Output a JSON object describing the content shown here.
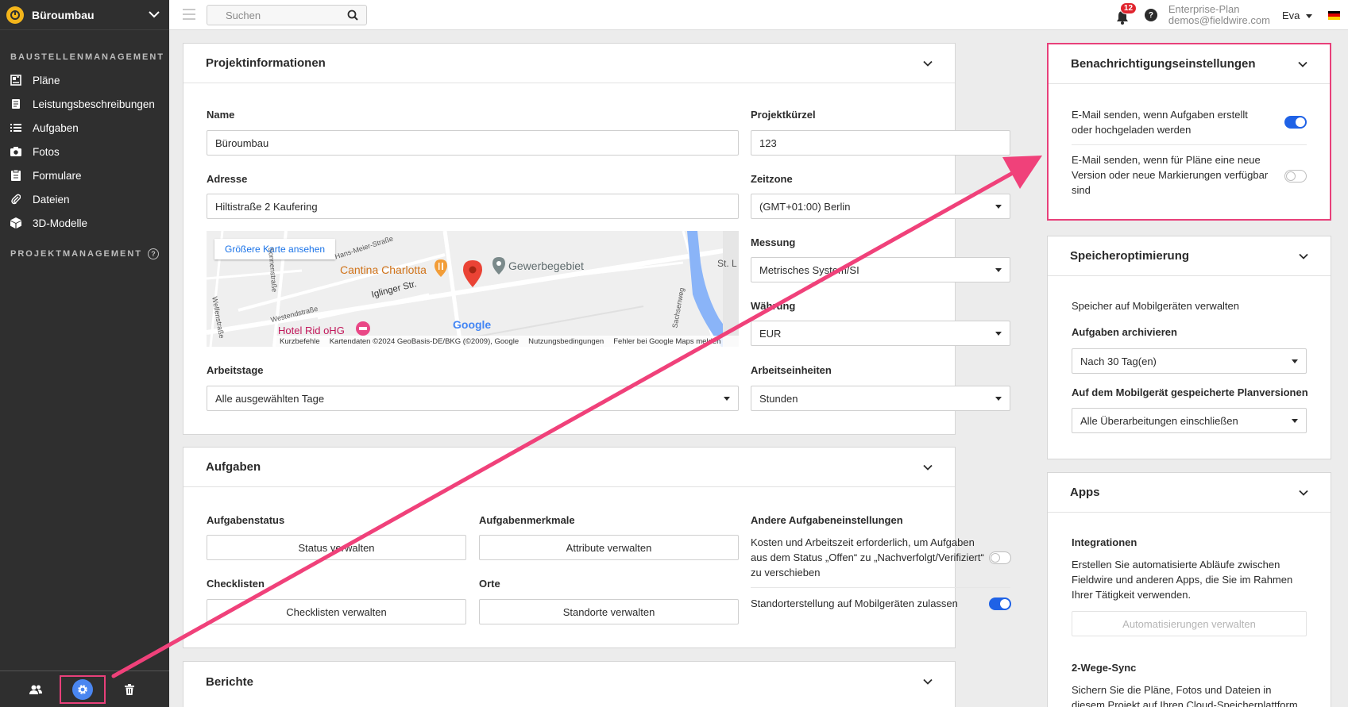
{
  "sidebar": {
    "project_name": "Büroumbau",
    "section_label": "BAUSTELLENMANAGEMENT",
    "items": [
      {
        "label": "Pläne",
        "icon": "plans-icon"
      },
      {
        "label": "Leistungsbeschreibungen",
        "icon": "specifications-icon"
      },
      {
        "label": "Aufgaben",
        "icon": "tasks-icon"
      },
      {
        "label": "Fotos",
        "icon": "camera-icon"
      },
      {
        "label": "Formulare",
        "icon": "forms-icon"
      },
      {
        "label": "Dateien",
        "icon": "paperclip-icon"
      },
      {
        "label": "3D-Modelle",
        "icon": "cube-icon"
      }
    ],
    "pm_label": "PROJEKTMANAGEMENT",
    "help_glyph": "?"
  },
  "topbar": {
    "search_placeholder": "Suchen",
    "notification_count": "12",
    "help_glyph": "?",
    "plan_name": "Enterprise-Plan",
    "account_email": "demos@fieldwire.com",
    "user_name": "Eva"
  },
  "project_info": {
    "title": "Projektinformationen",
    "name_label": "Name",
    "name_value": "Büroumbau",
    "code_label": "Projektkürzel",
    "code_value": "123",
    "address_label": "Adresse",
    "address_value": "Hiltistraße 2 Kaufering",
    "timezone_label": "Zeitzone",
    "timezone_value": "(GMT+01:00) Berlin",
    "measure_label": "Messung",
    "measure_value": "Metrisches System/SI",
    "currency_label": "Währung",
    "currency_value": "EUR",
    "workdays_label": "Arbeitstage",
    "workdays_value": "Alle ausgewählten Tage",
    "workunits_label": "Arbeitseinheiten",
    "workunits_value": "Stunden",
    "map": {
      "button": "Größere Karte ansehen",
      "place1": "Cantina Charlotta",
      "place2": "Gewerbegebiet",
      "place3": "Hotel Rid oHG",
      "street1": "Iglinger Str.",
      "street2": "Hans-Meier-Straße",
      "street3": "Westendstraße",
      "street4": "Sonnenstraße",
      "street5": "Welfenstraße",
      "street6": "Sachsenweg",
      "place4": "St. L",
      "brand": "Google",
      "footer1": "Kurzbefehle",
      "footer2": "Kartendaten ©2024 GeoBasis-DE/BKG (©2009), Google",
      "footer3": "Nutzungsbedingungen",
      "footer4": "Fehler bei Google Maps melden"
    }
  },
  "tasks": {
    "title": "Aufgaben",
    "status_label": "Aufgabenstatus",
    "status_button": "Status verwalten",
    "attributes_label": "Aufgabenmerkmale",
    "attributes_button": "Attribute verwalten",
    "other_label": "Andere Aufgabeneinstellungen",
    "other_text": "Kosten und Arbeitszeit erforderlich, um Aufgaben aus dem Status „Offen“ zu „Nachverfolgt/Verifiziert“ zu verschieben",
    "other_toggle": false,
    "location_text": "Standorterstellung auf Mobilgeräten zulassen",
    "location_toggle": true,
    "checklists_label": "Checklisten",
    "checklists_button": "Checklisten verwalten",
    "places_label": "Orte",
    "places_button": "Standorte verwalten"
  },
  "reports": {
    "title": "Berichte"
  },
  "notifications": {
    "title": "Benachrichtigungseinstellungen",
    "item1": "E-Mail senden, wenn Aufgaben erstellt oder hochgeladen werden",
    "item1_toggle": true,
    "item2": "E-Mail senden, wenn für Pläne eine neue Version oder neue Markierungen verfügbar sind",
    "item2_toggle": false
  },
  "storage": {
    "title": "Speicheroptimierung",
    "subtitle": "Speicher auf Mobilgeräten verwalten",
    "archive_label": "Aufgaben archivieren",
    "archive_value": "Nach 30 Tag(en)",
    "versions_label": "Auf dem Mobilgerät gespeicherte Planversionen",
    "versions_value": "Alle Überarbeitungen einschließen"
  },
  "apps": {
    "title": "Apps",
    "integrations_label": "Integrationen",
    "integrations_text": "Erstellen Sie automatisierte Abläufe zwischen Fieldwire und anderen Apps, die Sie im Rahmen Ihrer Tätigkeit verwenden.",
    "automation_button": "Automatisierungen verwalten",
    "sync_label": "2-Wege-Sync",
    "sync_text": "Sichern Sie die Pläne, Fotos und Dateien in diesem Projekt auf Ihren Cloud-Speicherplattform"
  },
  "colors": {
    "sidebar_bg": "#2f2f2f",
    "accent_blue": "#1f62e6",
    "highlight_pink": "#e8407a",
    "badge_red": "#e0242e"
  }
}
